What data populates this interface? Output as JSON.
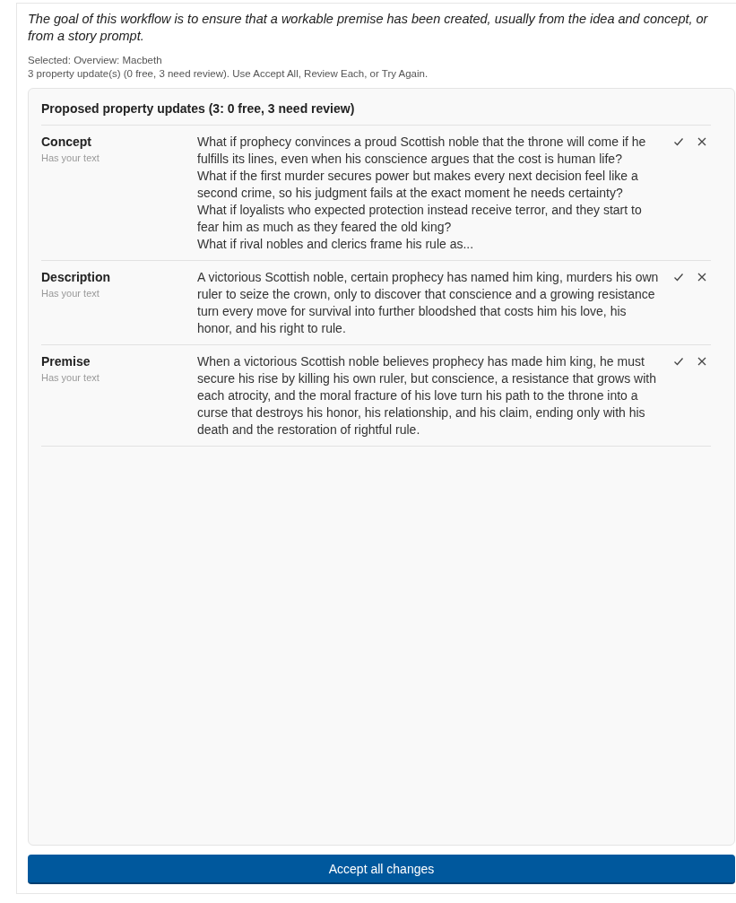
{
  "intro": "The goal of this workflow is to ensure that a workable premise has been created, usually from the idea and concept, or from a story prompt.",
  "selected": "Selected: Overview: Macbeth",
  "summary": "3 property update(s) (0 free, 3 need review). Use Accept All, Review Each, or Try Again.",
  "panel": {
    "title": "Proposed property updates (3: 0 free, 3 need review)",
    "updates": [
      {
        "name": "Concept",
        "note": "Has your text",
        "lines": [
          "What if prophecy convinces a proud Scottish noble that the throne will come if he fulfills its lines, even when his conscience argues that the cost is human life?",
          "What if the first murder secures power but makes every next decision feel like a second crime, so his judgment fails at the exact moment he needs certainty?",
          "What if loyalists who expected protection instead receive terror, and they start to fear him as much as they feared the old king?",
          "What if rival nobles and clerics frame his rule as..."
        ]
      },
      {
        "name": "Description",
        "note": "Has your text",
        "lines": [
          "A victorious Scottish noble, certain prophecy has named him king, murders his own ruler to seize the crown, only to discover that conscience and a growing resistance turn every move for survival into further bloodshed that costs him his love, his honor, and his right to rule."
        ]
      },
      {
        "name": "Premise",
        "note": "Has your text",
        "lines": [
          "When a victorious Scottish noble believes prophecy has made him king, he must secure his rise by killing his own ruler, but conscience, a resistance that grows with each atrocity, and the moral fracture of his love turn his path to the throne into a curse that destroys his honor, his relationship, and his claim, ending only with his death and the restoration of rightful rule."
        ]
      }
    ]
  },
  "accept_button": "Accept all changes"
}
